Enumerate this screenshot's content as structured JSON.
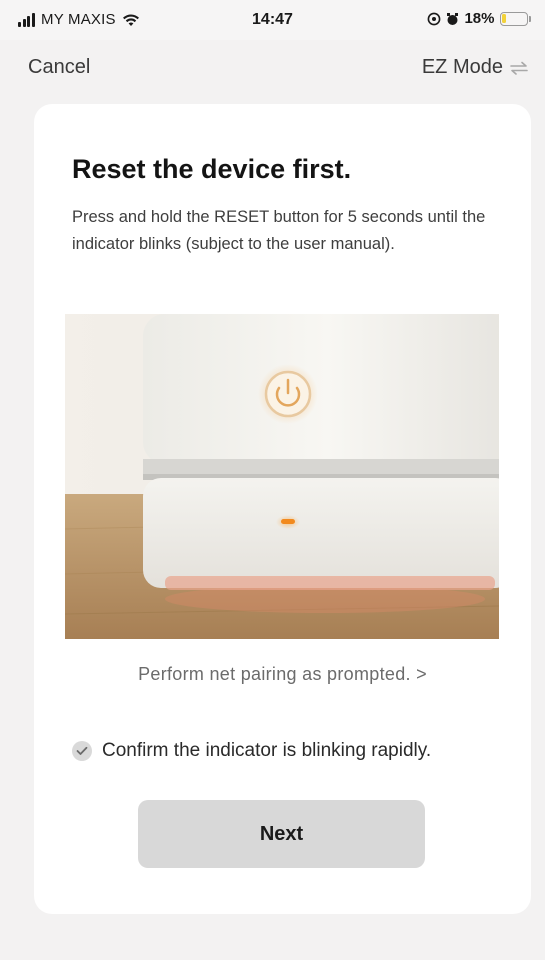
{
  "status_bar": {
    "carrier": "MY MAXIS",
    "time": "14:47",
    "battery": "18%",
    "battery_level": 0.18,
    "battery_color": "#f2d23a"
  },
  "nav": {
    "cancel_label": "Cancel",
    "mode_label": "EZ Mode",
    "mode_icon": "swap-arrows-icon"
  },
  "card": {
    "title": "Reset the device first.",
    "description": "Press and hold the RESET button for 5 seconds until the indicator blinks (subject to the user manual).",
    "image_icon": "device-reset-illustration",
    "pairing_link": "Perform net pairing as prompted. >",
    "confirm_text": "Confirm the indicator is blinking rapidly.",
    "confirm_checked": false,
    "next_label": "Next",
    "indicator_color": "#f28a1e"
  }
}
